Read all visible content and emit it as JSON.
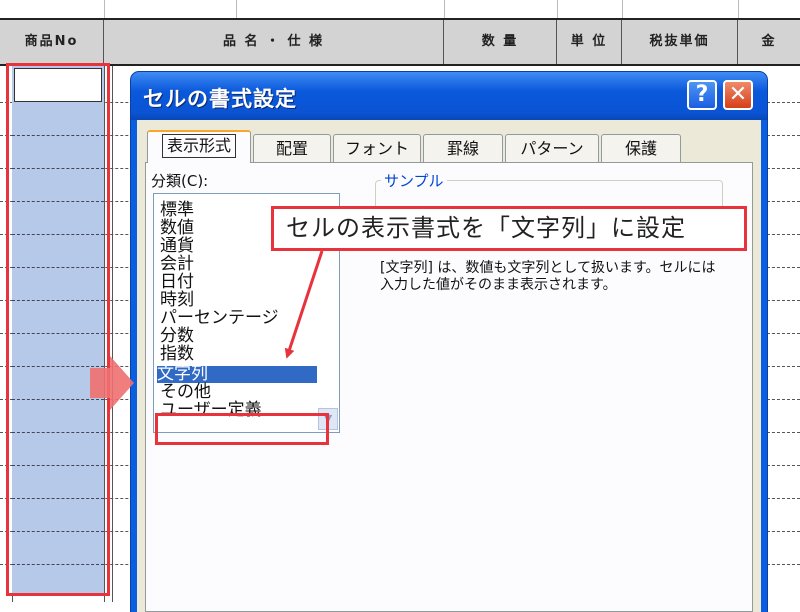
{
  "sheet": {
    "headers": [
      "商品No",
      "品 名 ・ 仕 様",
      "数 量",
      "単 位",
      "税抜単価",
      "金"
    ]
  },
  "dialog": {
    "title": "セルの書式設定",
    "help_glyph": "?",
    "close_glyph": "✕",
    "tabs": [
      "表示形式",
      "配置",
      "フォント",
      "罫線",
      "パターン",
      "保護"
    ],
    "active_tab": "表示形式",
    "category_label": "分類(C):",
    "categories": [
      "標準",
      "数値",
      "通貨",
      "会計",
      "日付",
      "時刻",
      "パーセンテージ",
      "分数",
      "指数",
      "文字列",
      "その他",
      "ユーザー定義"
    ],
    "selected_category": "文字列",
    "sample_label": "サンプル",
    "description": "[文字列] は、数値も文字列として扱います。セルには入力した値がそのまま表示されます。"
  },
  "annotation": {
    "callout": "セルの表示書式を「文字列」に設定",
    "accent_color": "#e8323c",
    "pointer_color": "#f07070"
  }
}
